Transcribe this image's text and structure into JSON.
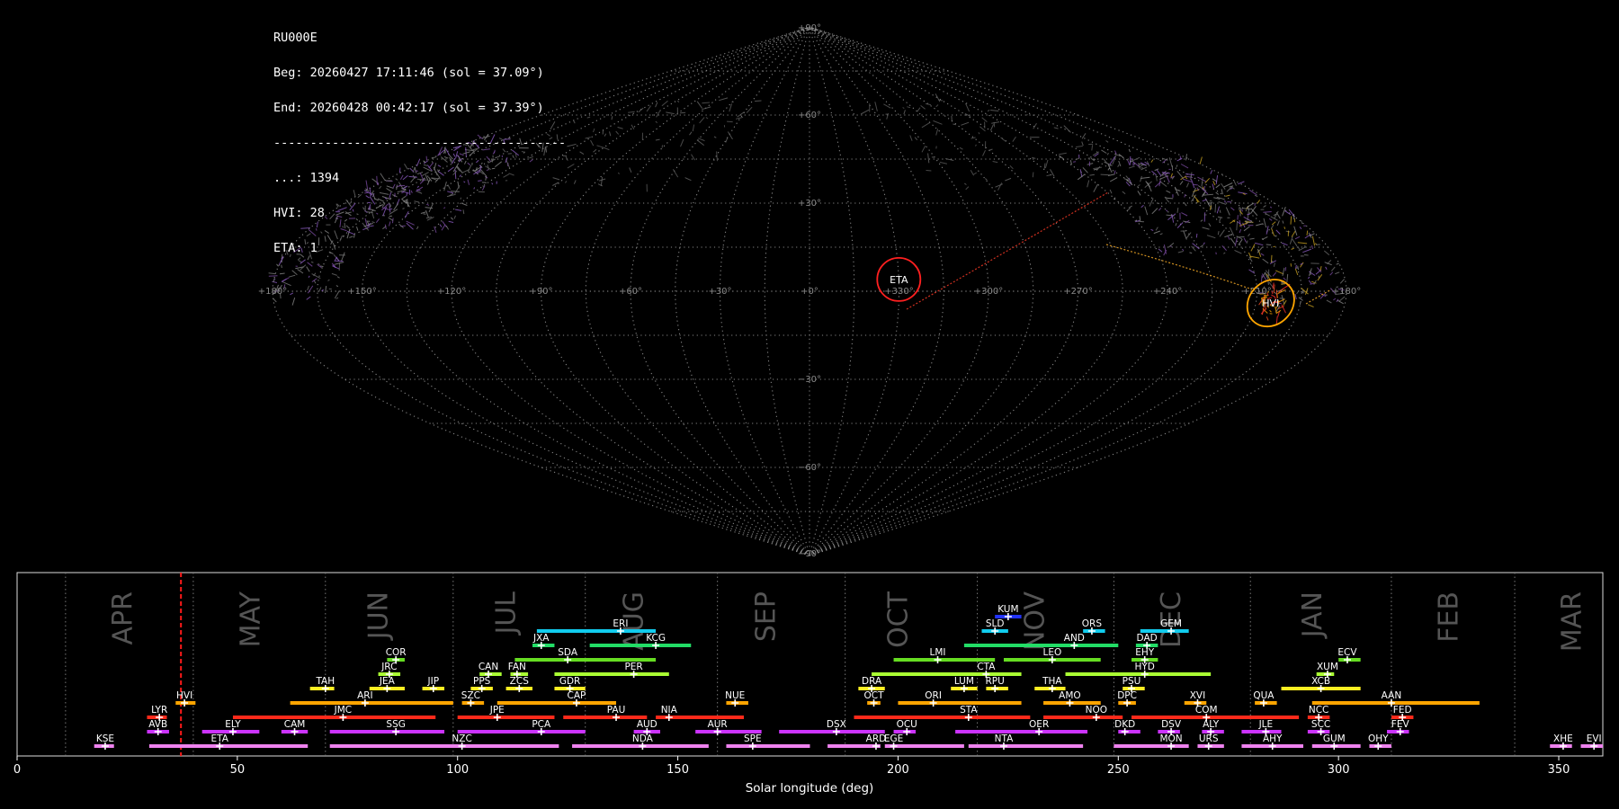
{
  "info": {
    "station": "RU000E",
    "beg": "Beg: 20260427 17:11:46 (sol = 37.09°)",
    "end": "End: 20260428 00:42:17 (sol = 37.39°)",
    "rule": "----------------------------------------",
    "counts": [
      {
        "label": "...: 1394"
      },
      {
        "label": "HVI: 28"
      },
      {
        "label": "ETA: 1"
      }
    ]
  },
  "sky_map": {
    "lat_labels": [
      {
        "lat": 90,
        "text": "+90°"
      },
      {
        "lat": 60,
        "text": "+60°"
      },
      {
        "lat": 30,
        "text": "+30°"
      },
      {
        "lat": -30,
        "text": "−30°"
      },
      {
        "lat": -60,
        "text": "−60°"
      },
      {
        "lat": -90,
        "text": "−90°"
      }
    ],
    "lon_labels": [
      {
        "lon": 180,
        "text": "+180°"
      },
      {
        "lon": 150,
        "text": "+150°"
      },
      {
        "lon": 120,
        "text": "+120°"
      },
      {
        "lon": 90,
        "text": "+90°"
      },
      {
        "lon": 60,
        "text": "+60°"
      },
      {
        "lon": 30,
        "text": "+30°"
      },
      {
        "lon": 0,
        "text": "+0°"
      },
      {
        "lon": -30,
        "text": "+330°"
      },
      {
        "lon": -60,
        "text": "+300°"
      },
      {
        "lon": -90,
        "text": "+270°"
      },
      {
        "lon": -120,
        "text": "+240°"
      },
      {
        "lon": -150,
        "text": "+210°"
      },
      {
        "lon": -180,
        "text": "+180°"
      }
    ],
    "radiants": [
      {
        "name": "ETA",
        "lon": -30,
        "lat": 4,
        "circle_color": "#ff2020"
      },
      {
        "name": "HVI",
        "lon": -155,
        "lat": -4,
        "circle_color": "#ffa500"
      }
    ]
  },
  "chart_data": {
    "type": "timeline",
    "xlabel": "Solar longitude (deg)",
    "xlim": [
      0,
      360
    ],
    "x_ticks": [
      0,
      50,
      100,
      150,
      200,
      250,
      300,
      350
    ],
    "current_sol": 37.2,
    "month_labels": [
      {
        "name": "APR",
        "sol": 24
      },
      {
        "name": "MAY",
        "sol": 53
      },
      {
        "name": "JUN",
        "sol": 82
      },
      {
        "name": "JUL",
        "sol": 111
      },
      {
        "name": "AUG",
        "sol": 140
      },
      {
        "name": "SEP",
        "sol": 170
      },
      {
        "name": "OCT",
        "sol": 200
      },
      {
        "name": "NOV",
        "sol": 231
      },
      {
        "name": "DEC",
        "sol": 262
      },
      {
        "name": "JAN",
        "sol": 294
      },
      {
        "name": "FEB",
        "sol": 325
      },
      {
        "name": "MAR",
        "sol": 353
      }
    ],
    "month_boundaries": [
      11,
      40,
      70,
      99,
      129,
      159,
      188,
      218,
      249,
      280,
      312,
      340
    ],
    "showers": [
      {
        "code": "KSE",
        "start": 17.5,
        "end": 22,
        "peak": 20,
        "row": 0,
        "color": "#ee82ee"
      },
      {
        "code": "ETA",
        "start": 30,
        "end": 66,
        "peak": 46,
        "row": 0,
        "color": "#ee82ee"
      },
      {
        "code": "NZC",
        "start": 71,
        "end": 123,
        "peak": 101,
        "row": 0,
        "color": "#ee82ee"
      },
      {
        "code": "NDA",
        "start": 126,
        "end": 157,
        "peak": 142,
        "row": 0,
        "color": "#ee82ee"
      },
      {
        "code": "SPE",
        "start": 161,
        "end": 180,
        "peak": 167,
        "row": 0,
        "color": "#ee82ee"
      },
      {
        "code": "ARD",
        "start": 184,
        "end": 196,
        "peak": 195,
        "row": 0,
        "color": "#ee82ee"
      },
      {
        "code": "EGE",
        "start": 197,
        "end": 215,
        "peak": 199,
        "row": 0,
        "color": "#ee82ee"
      },
      {
        "code": "NTA",
        "start": 216,
        "end": 242,
        "peak": 224,
        "row": 0,
        "color": "#ee82ee"
      },
      {
        "code": "MON",
        "start": 249,
        "end": 266,
        "peak": 262,
        "row": 0,
        "color": "#ee82ee"
      },
      {
        "code": "URS",
        "start": 268,
        "end": 274,
        "peak": 270.5,
        "row": 0,
        "color": "#ee82ee"
      },
      {
        "code": "AHY",
        "start": 278,
        "end": 292,
        "peak": 285,
        "row": 0,
        "color": "#ee82ee"
      },
      {
        "code": "GUM",
        "start": 294,
        "end": 305,
        "peak": 299,
        "row": 0,
        "color": "#ee82ee"
      },
      {
        "code": "OHY",
        "start": 307,
        "end": 312,
        "peak": 309,
        "row": 0,
        "color": "#ee82ee"
      },
      {
        "code": "XHE",
        "start": 348,
        "end": 353,
        "peak": 351,
        "row": 0,
        "color": "#ee82ee"
      },
      {
        "code": "EVI",
        "start": 355,
        "end": 360,
        "peak": 358,
        "row": 0,
        "color": "#ee82ee"
      },
      {
        "code": "AVB",
        "start": 29.5,
        "end": 34.5,
        "peak": 32,
        "row": 1,
        "color": "#cc33ff"
      },
      {
        "code": "ELY",
        "start": 42,
        "end": 55,
        "peak": 49,
        "row": 1,
        "color": "#cc33ff"
      },
      {
        "code": "CAM",
        "start": 60,
        "end": 66,
        "peak": 63,
        "row": 1,
        "color": "#cc33ff"
      },
      {
        "code": "SSG",
        "start": 71,
        "end": 97,
        "peak": 86,
        "row": 1,
        "color": "#cc33ff"
      },
      {
        "code": "PCA",
        "start": 100,
        "end": 129,
        "peak": 119,
        "row": 1,
        "color": "#cc33ff"
      },
      {
        "code": "AUD",
        "start": 140,
        "end": 146,
        "peak": 143,
        "row": 1,
        "color": "#cc33ff"
      },
      {
        "code": "AUR",
        "start": 154,
        "end": 169,
        "peak": 159,
        "row": 1,
        "color": "#cc33ff"
      },
      {
        "code": "DSX",
        "start": 173,
        "end": 197,
        "peak": 186,
        "row": 1,
        "color": "#cc33ff"
      },
      {
        "code": "OCU",
        "start": 199,
        "end": 204,
        "peak": 202,
        "row": 1,
        "color": "#cc33ff"
      },
      {
        "code": "OER",
        "start": 213,
        "end": 243,
        "peak": 232,
        "row": 1,
        "color": "#cc33ff"
      },
      {
        "code": "DKD",
        "start": 250,
        "end": 255,
        "peak": 251.5,
        "row": 1,
        "color": "#cc33ff"
      },
      {
        "code": "DSV",
        "start": 259,
        "end": 264,
        "peak": 262,
        "row": 1,
        "color": "#cc33ff"
      },
      {
        "code": "ALY",
        "start": 269,
        "end": 274,
        "peak": 271,
        "row": 1,
        "color": "#cc33ff"
      },
      {
        "code": "JLE",
        "start": 278,
        "end": 287,
        "peak": 283.5,
        "row": 1,
        "color": "#cc33ff"
      },
      {
        "code": "SCC",
        "start": 293,
        "end": 298,
        "peak": 296,
        "row": 1,
        "color": "#cc33ff"
      },
      {
        "code": "FEV",
        "start": 311,
        "end": 316,
        "peak": 314,
        "row": 1,
        "color": "#cc33ff"
      },
      {
        "code": "LYR",
        "start": 29.5,
        "end": 34,
        "peak": 32.3,
        "row": 2,
        "color": "#ff2a1a"
      },
      {
        "code": "JMC",
        "start": 49,
        "end": 95,
        "peak": 74,
        "row": 2,
        "color": "#ff2a1a"
      },
      {
        "code": "JPE",
        "start": 100,
        "end": 122,
        "peak": 109,
        "row": 2,
        "color": "#ff2a1a"
      },
      {
        "code": "PAU",
        "start": 124,
        "end": 143,
        "peak": 136,
        "row": 2,
        "color": "#ff2a1a"
      },
      {
        "code": "NIA",
        "start": 145,
        "end": 165,
        "peak": 148,
        "row": 2,
        "color": "#ff2a1a"
      },
      {
        "code": "STA",
        "start": 190,
        "end": 230,
        "peak": 216,
        "row": 2,
        "color": "#ff2a1a"
      },
      {
        "code": "NOO",
        "start": 233,
        "end": 251,
        "peak": 245,
        "row": 2,
        "color": "#ff2a1a"
      },
      {
        "code": "COM",
        "start": 253,
        "end": 291,
        "peak": 270,
        "row": 2,
        "color": "#ff2a1a"
      },
      {
        "code": "NCC",
        "start": 293,
        "end": 298,
        "peak": 295.5,
        "row": 2,
        "color": "#ff2a1a"
      },
      {
        "code": "FED",
        "start": 312,
        "end": 317,
        "peak": 314.5,
        "row": 2,
        "color": "#ff2a1a"
      },
      {
        "code": "HVI",
        "start": 36,
        "end": 40.5,
        "peak": 38,
        "row": 3,
        "color": "#ffa500"
      },
      {
        "code": "ARI",
        "start": 62,
        "end": 99,
        "peak": 79,
        "row": 3,
        "color": "#ffa500"
      },
      {
        "code": "SZC",
        "start": 101,
        "end": 106,
        "peak": 103,
        "row": 3,
        "color": "#ffa500"
      },
      {
        "code": "CAP",
        "start": 109,
        "end": 136,
        "peak": 127,
        "row": 3,
        "color": "#ffa500"
      },
      {
        "code": "NUE",
        "start": 161,
        "end": 166,
        "peak": 163,
        "row": 3,
        "color": "#ffa500"
      },
      {
        "code": "OCT",
        "start": 193,
        "end": 196,
        "peak": 194.5,
        "row": 3,
        "color": "#ffa500"
      },
      {
        "code": "ORI",
        "start": 200,
        "end": 228,
        "peak": 208,
        "row": 3,
        "color": "#ffa500"
      },
      {
        "code": "AMO",
        "start": 233,
        "end": 246,
        "peak": 239,
        "row": 3,
        "color": "#ffa500"
      },
      {
        "code": "DPC",
        "start": 250,
        "end": 254,
        "peak": 252,
        "row": 3,
        "color": "#ffa500"
      },
      {
        "code": "XVI",
        "start": 265,
        "end": 270,
        "peak": 268,
        "row": 3,
        "color": "#ffa500"
      },
      {
        "code": "QUA",
        "start": 281,
        "end": 286,
        "peak": 283,
        "row": 3,
        "color": "#ffa500"
      },
      {
        "code": "AAN",
        "start": 294,
        "end": 332,
        "peak": 312,
        "row": 3,
        "color": "#ffa500"
      },
      {
        "code": "TAH",
        "start": 66.5,
        "end": 72,
        "peak": 70,
        "row": 4,
        "color": "#ffee22"
      },
      {
        "code": "JEA",
        "start": 80,
        "end": 88,
        "peak": 84,
        "row": 4,
        "color": "#ffee22"
      },
      {
        "code": "JIP",
        "start": 92,
        "end": 97,
        "peak": 94.5,
        "row": 4,
        "color": "#ffee22"
      },
      {
        "code": "PPS",
        "start": 103,
        "end": 108,
        "peak": 105.5,
        "row": 4,
        "color": "#ffee22"
      },
      {
        "code": "ZCS",
        "start": 111,
        "end": 117,
        "peak": 114,
        "row": 4,
        "color": "#ffee22"
      },
      {
        "code": "GDR",
        "start": 122,
        "end": 129,
        "peak": 125.5,
        "row": 4,
        "color": "#ffee22"
      },
      {
        "code": "DRA",
        "start": 191,
        "end": 197,
        "peak": 194,
        "row": 4,
        "color": "#ffee22"
      },
      {
        "code": "LUM",
        "start": 212,
        "end": 218,
        "peak": 215,
        "row": 4,
        "color": "#ffee22"
      },
      {
        "code": "RPU",
        "start": 220,
        "end": 225,
        "peak": 222,
        "row": 4,
        "color": "#ffee22"
      },
      {
        "code": "THA",
        "start": 231,
        "end": 238,
        "peak": 235,
        "row": 4,
        "color": "#ffee22"
      },
      {
        "code": "PSU",
        "start": 251,
        "end": 256,
        "peak": 253,
        "row": 4,
        "color": "#ffee22"
      },
      {
        "code": "XCB",
        "start": 287,
        "end": 305,
        "peak": 296,
        "row": 4,
        "color": "#ffee22"
      },
      {
        "code": "JRC",
        "start": 82,
        "end": 87,
        "peak": 84.5,
        "row": 5,
        "color": "#aaff33"
      },
      {
        "code": "CAN",
        "start": 105,
        "end": 110,
        "peak": 107,
        "row": 5,
        "color": "#aaff33"
      },
      {
        "code": "FAN",
        "start": 112,
        "end": 116,
        "peak": 113.5,
        "row": 5,
        "color": "#aaff33"
      },
      {
        "code": "PER",
        "start": 122,
        "end": 148,
        "peak": 140,
        "row": 5,
        "color": "#aaff33"
      },
      {
        "code": "CTA",
        "start": 194,
        "end": 228,
        "peak": 220,
        "row": 5,
        "color": "#aaff33"
      },
      {
        "code": "HYD",
        "start": 238,
        "end": 271,
        "peak": 256,
        "row": 5,
        "color": "#aaff33"
      },
      {
        "code": "XUM",
        "start": 295,
        "end": 299,
        "peak": 297.5,
        "row": 5,
        "color": "#aaff33"
      },
      {
        "code": "COR",
        "start": 84,
        "end": 88,
        "peak": 86,
        "row": 6,
        "color": "#66dd22"
      },
      {
        "code": "SDA",
        "start": 113,
        "end": 145,
        "peak": 125,
        "row": 6,
        "color": "#66dd22"
      },
      {
        "code": "LMI",
        "start": 199,
        "end": 222,
        "peak": 209,
        "row": 6,
        "color": "#66dd22"
      },
      {
        "code": "LEO",
        "start": 224,
        "end": 246,
        "peak": 235,
        "row": 6,
        "color": "#66dd22"
      },
      {
        "code": "EHY",
        "start": 253,
        "end": 259,
        "peak": 256,
        "row": 6,
        "color": "#66dd22"
      },
      {
        "code": "ECV",
        "start": 300,
        "end": 305,
        "peak": 302,
        "row": 6,
        "color": "#66dd22"
      },
      {
        "code": "JXA",
        "start": 117,
        "end": 122,
        "peak": 119,
        "row": 7,
        "color": "#22dd66"
      },
      {
        "code": "KCG",
        "start": 130,
        "end": 153,
        "peak": 145,
        "row": 7,
        "color": "#22dd66"
      },
      {
        "code": "AND",
        "start": 215,
        "end": 250,
        "peak": 240,
        "row": 7,
        "color": "#22dd66"
      },
      {
        "code": "DAD",
        "start": 254,
        "end": 259,
        "peak": 256.5,
        "row": 7,
        "color": "#22dd66"
      },
      {
        "code": "ERI",
        "start": 118,
        "end": 145,
        "peak": 137,
        "row": 8,
        "color": "#11ccee"
      },
      {
        "code": "SLD",
        "start": 219,
        "end": 225,
        "peak": 222,
        "row": 8,
        "color": "#11ccee"
      },
      {
        "code": "ORS",
        "start": 242,
        "end": 247,
        "peak": 244,
        "row": 8,
        "color": "#11ccee"
      },
      {
        "code": "GEM",
        "start": 255,
        "end": 266,
        "peak": 262,
        "row": 8,
        "color": "#11ccee"
      },
      {
        "code": "KUM",
        "start": 222,
        "end": 228,
        "peak": 225,
        "row": 9,
        "color": "#2233ff"
      }
    ]
  }
}
